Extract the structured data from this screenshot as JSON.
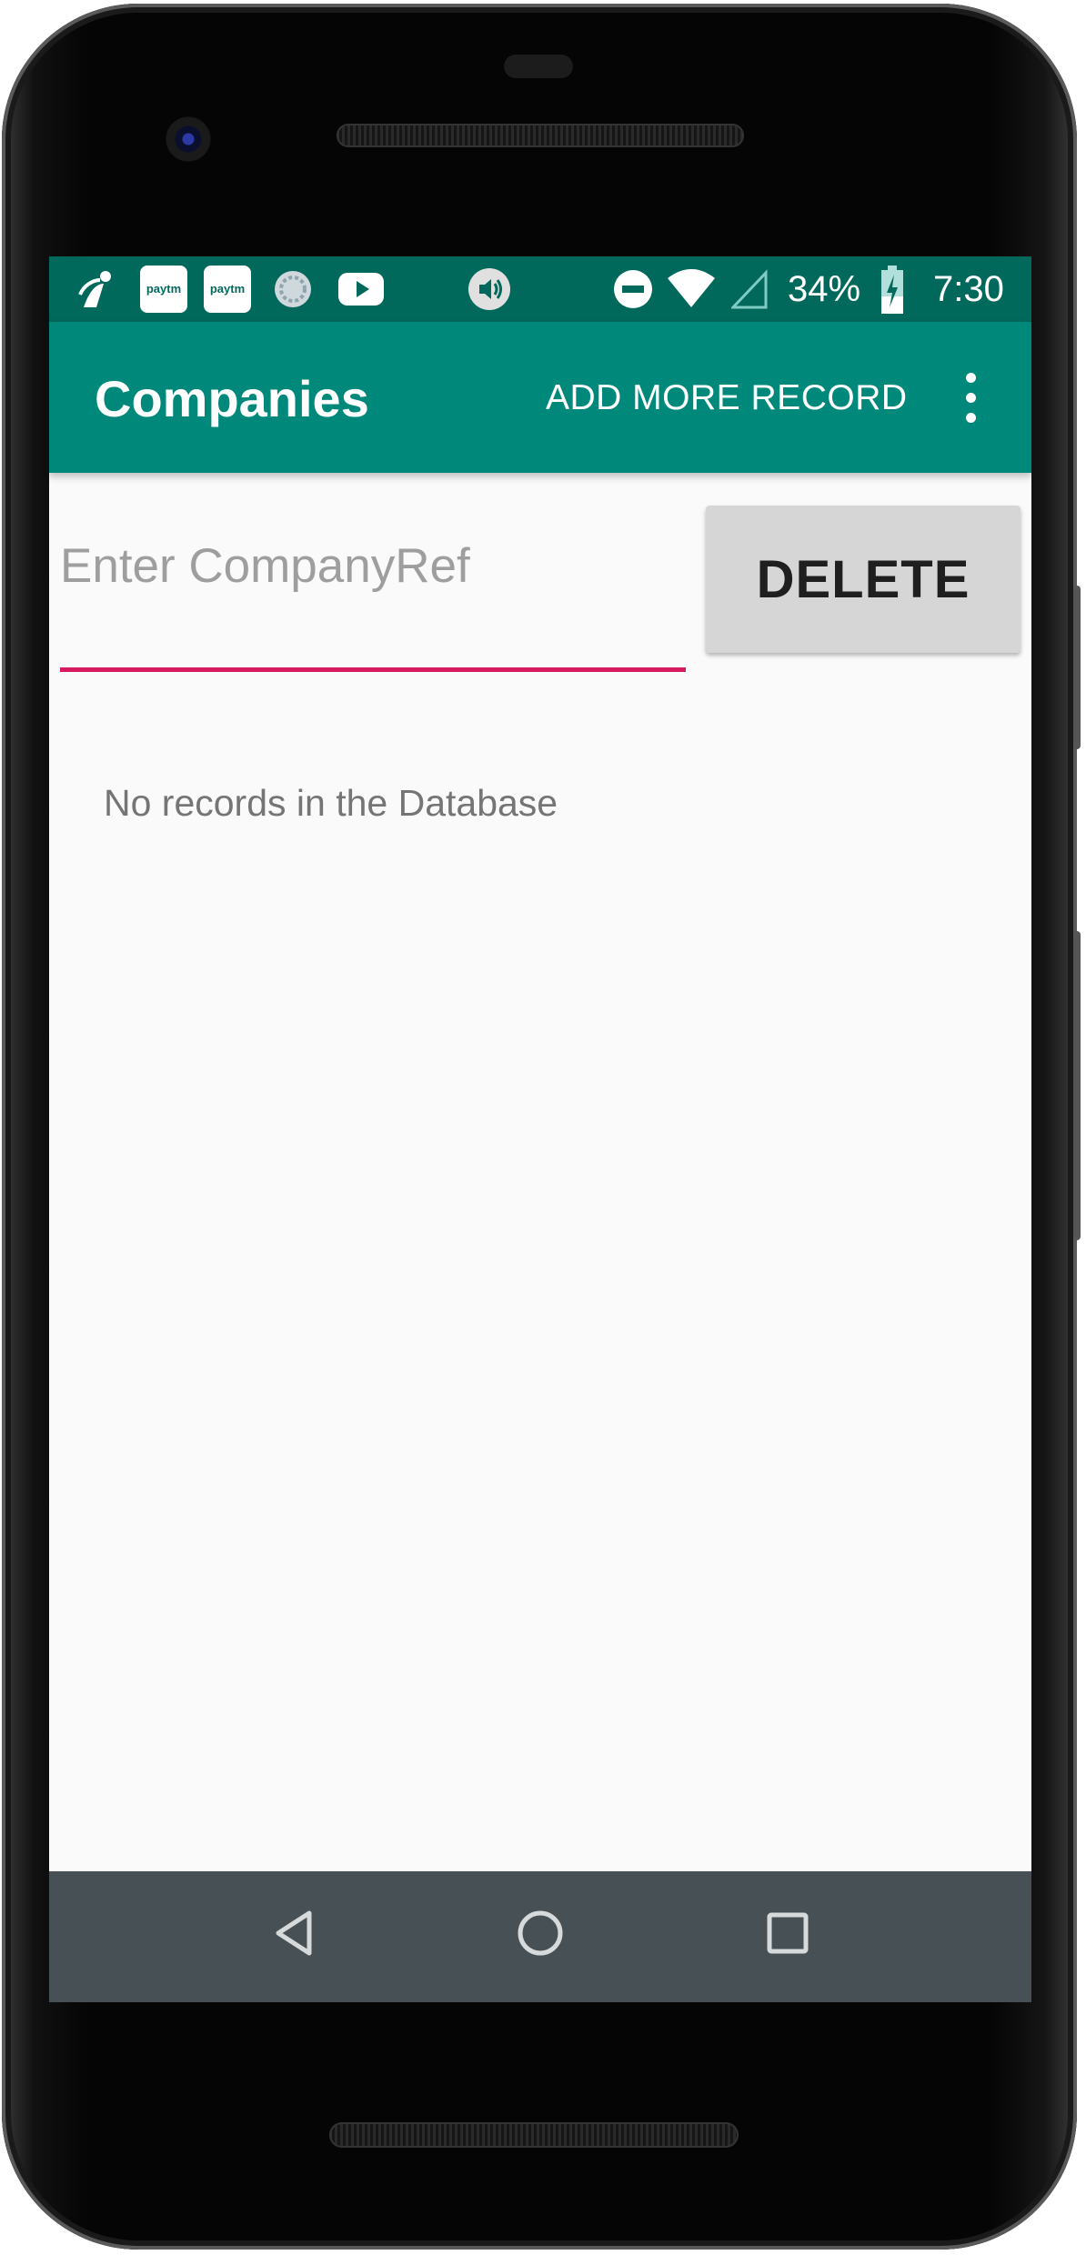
{
  "status_bar": {
    "battery": "34%",
    "time": "7:30",
    "notification_icons": [
      "imobile-icon",
      "paytm-icon",
      "paytm-icon",
      "sync-icon",
      "youtube-icon",
      "volume-icon"
    ],
    "paytm_label": "paytm",
    "system_icons": [
      "dnd-icon",
      "wifi-icon",
      "cell-signal-icon",
      "battery-charging-icon"
    ]
  },
  "app_bar": {
    "title": "Companies",
    "action_label": "ADD MORE RECORD",
    "overflow_icon": "more-vert-icon",
    "color": "#00897b",
    "status_color": "#00695c"
  },
  "form": {
    "company_ref_placeholder": "Enter CompanyRef",
    "company_ref_value": "",
    "delete_label": "DELETE",
    "accent_color": "#d81b60"
  },
  "content": {
    "empty_message": "No records in the Database"
  },
  "nav_bar": {
    "buttons": [
      "back-icon",
      "home-icon",
      "recents-icon"
    ]
  }
}
